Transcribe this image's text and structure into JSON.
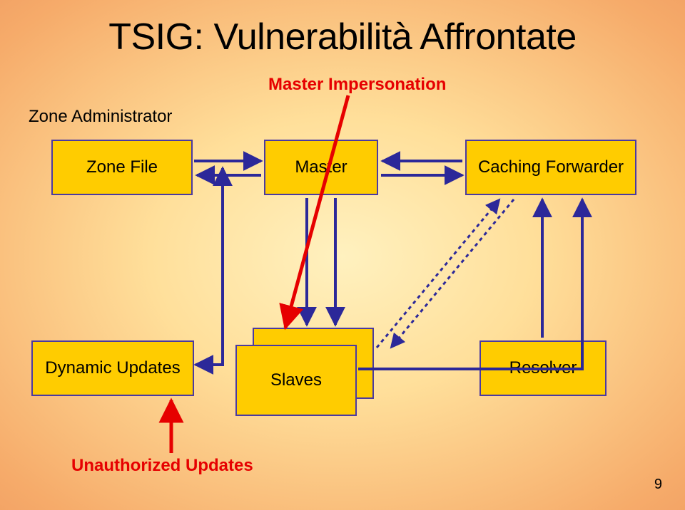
{
  "title": "TSIG: Vulnerabilità Affrontate",
  "labels": {
    "zone_administrator": "Zone Administrator",
    "master_impersonation": "Master Impersonation",
    "unauthorized_updates": "Unauthorized Updates"
  },
  "boxes": {
    "zone_file": "Zone File",
    "master": "Master",
    "caching_forwarder": "Caching Forwarder",
    "dynamic_updates": "Dynamic Updates",
    "slaves": "Slaves",
    "resolver": "Resolver"
  },
  "page_number": "9"
}
